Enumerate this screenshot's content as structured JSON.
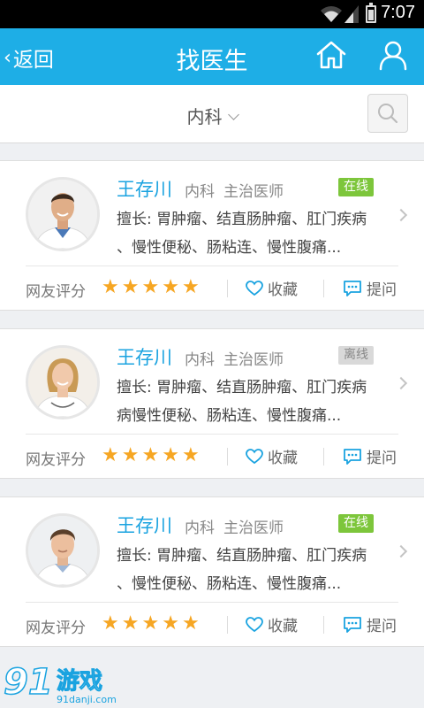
{
  "status_bar": {
    "time": "7:07"
  },
  "header": {
    "back_label": "返回",
    "title": "找医生",
    "home_icon": "home-icon",
    "user_icon": "user-icon",
    "color": "#1eaee6"
  },
  "filter": {
    "department": "内科",
    "search_icon": "search-icon"
  },
  "doctors": [
    {
      "name": "王存川",
      "department": "内科",
      "title": "主治医师",
      "status": "在线",
      "specialty_line1": "擅长: 胃肿瘤、结直肠肿瘤、肛门疾病",
      "specialty_line2": "、慢性便秘、肠粘连、慢性腹痛...",
      "rating_label": "网友评分",
      "rating": 5,
      "favorite_label": "收藏",
      "ask_label": "提问"
    },
    {
      "name": "王存川",
      "department": "内科",
      "title": "主治医师",
      "status": "离线",
      "specialty_line1": "擅长: 胃肿瘤、结直肠肿瘤、肛门疾病",
      "specialty_line2": "病慢性便秘、肠粘连、慢性腹痛...",
      "rating_label": "网友评分",
      "rating": 5,
      "favorite_label": "收藏",
      "ask_label": "提问"
    },
    {
      "name": "王存川",
      "department": "内科",
      "title": "主治医师",
      "status": "在线",
      "specialty_line1": "擅长: 胃肿瘤、结直肠肿瘤、肛门疾病",
      "specialty_line2": "、慢性便秘、肠粘连、慢性腹痛...",
      "rating_label": "网友评分",
      "rating": 5,
      "favorite_label": "收藏",
      "ask_label": "提问"
    }
  ],
  "watermark": {
    "logo_text": "91游戏",
    "site": "91danji.com"
  },
  "colors": {
    "online": "#7dc63b",
    "offline": "#d9d9d9",
    "star": "#f6a623",
    "name": "#1aa3e0"
  }
}
